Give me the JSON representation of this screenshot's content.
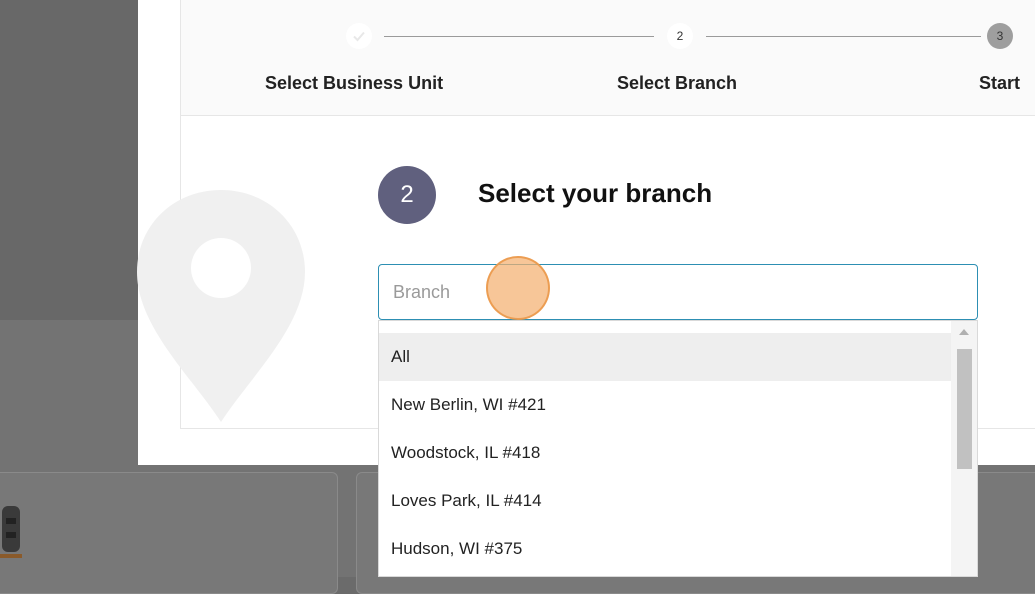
{
  "stepper": {
    "steps": [
      {
        "number": "",
        "label": "Select Business Unit",
        "state": "completed"
      },
      {
        "number": "2",
        "label": "Select Branch",
        "state": "active"
      },
      {
        "number": "3",
        "label": "Start",
        "state": "upcoming"
      }
    ]
  },
  "section": {
    "step_number": "2",
    "title": "Select your branch"
  },
  "branch_input": {
    "placeholder": "Branch",
    "value": ""
  },
  "dropdown": {
    "options": [
      "All",
      "New Berlin, WI #421",
      "Woodstock, IL #418",
      "Loves Park, IL #414",
      "Hudson, WI #375"
    ],
    "highlighted": "All"
  },
  "icons": {
    "pin": "map-pin-icon",
    "check": "check-icon"
  },
  "colors": {
    "accent": "#60607e",
    "input_border": "#2d8fb3",
    "click_marker": "#f4b070"
  }
}
